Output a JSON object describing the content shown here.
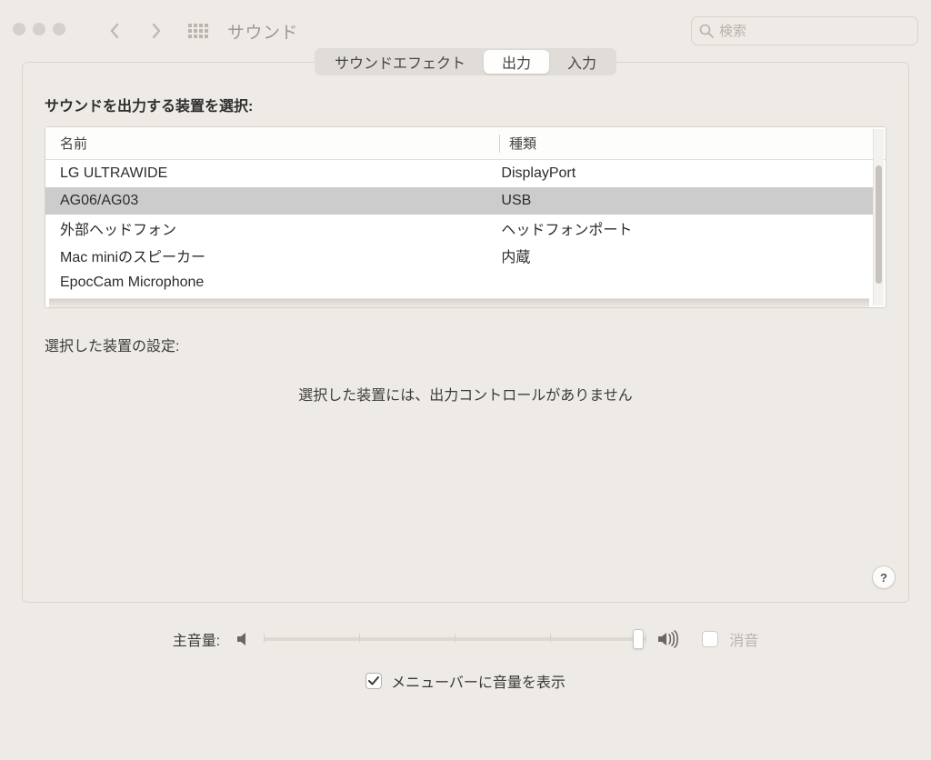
{
  "toolbar": {
    "title": "サウンド",
    "search_placeholder": "検索"
  },
  "tabs": {
    "effects": "サウンドエフェクト",
    "output": "出力",
    "input": "入力",
    "active_index": 1
  },
  "section_title": "サウンドを出力する装置を選択:",
  "columns": {
    "name": "名前",
    "type": "種類"
  },
  "devices": [
    {
      "name": "LG ULTRAWIDE",
      "type": "DisplayPort",
      "selected": false
    },
    {
      "name": "AG06/AG03",
      "type": "USB",
      "selected": true
    },
    {
      "name": "外部ヘッドフォン",
      "type": "ヘッドフォンポート",
      "selected": false
    },
    {
      "name": "Mac miniのスピーカー",
      "type": "内蔵",
      "selected": false
    },
    {
      "name": "EpocCam Microphone",
      "type": "",
      "selected": false
    }
  ],
  "settings_label": "選択した装置の設定:",
  "no_controls": "選択した装置には、出力コントロールがありません",
  "help_label": "?",
  "volume": {
    "label": "主音量:",
    "value_percent": 98,
    "mute_label": "消音",
    "muted": false,
    "show_in_menubar_label": "メニューバーに音量を表示",
    "show_in_menubar": true
  }
}
